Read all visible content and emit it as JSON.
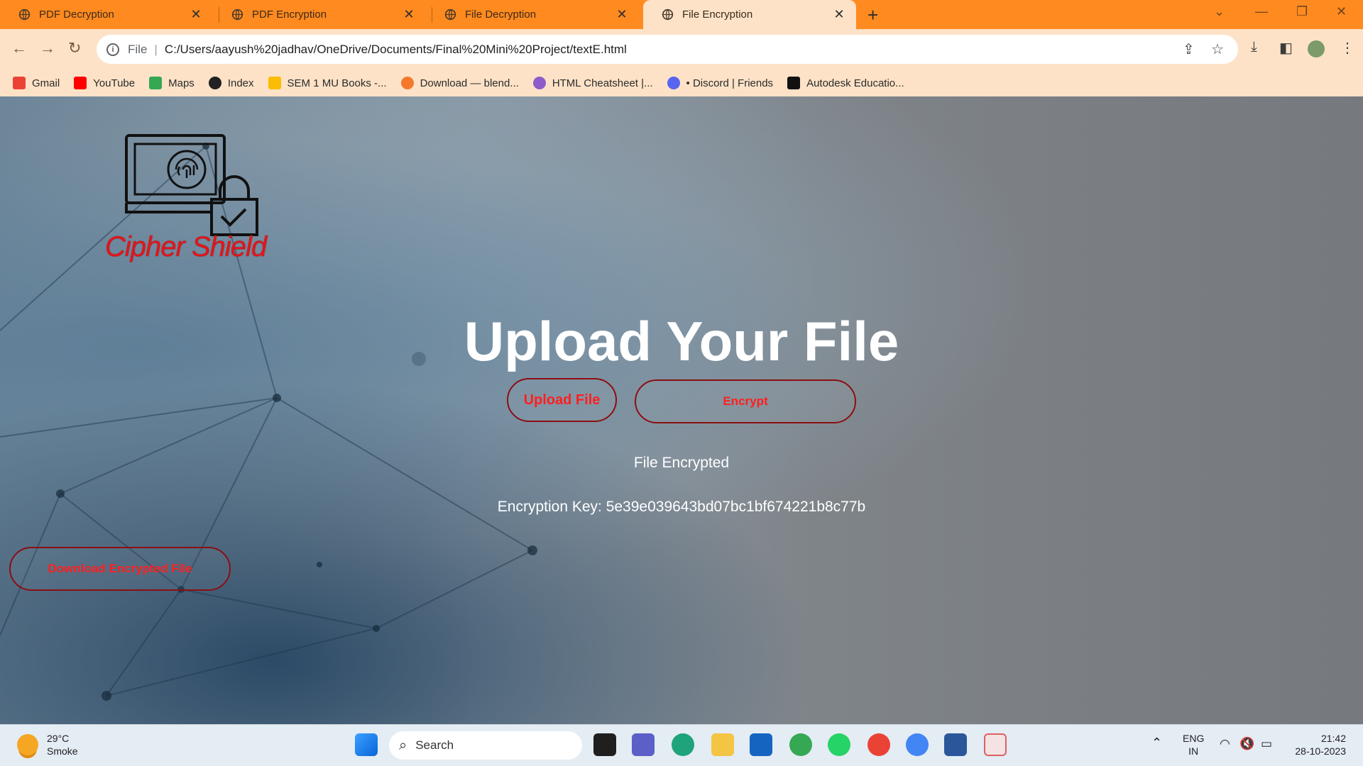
{
  "browser": {
    "tabs": [
      {
        "label": "PDF Decryption",
        "active": false
      },
      {
        "label": "PDF Encryption",
        "active": false
      },
      {
        "label": "File Decryption",
        "active": false
      },
      {
        "label": "File Encryption",
        "active": true
      }
    ],
    "address": {
      "scheme": "File",
      "url": "C:/Users/aayush%20jadhav/OneDrive/Documents/Final%20Mini%20Project/textE.html"
    },
    "bookmarks": [
      {
        "label": "Gmail",
        "color": "#ea4335"
      },
      {
        "label": "YouTube",
        "color": "#ff0000"
      },
      {
        "label": "Maps",
        "color": "#34a853"
      },
      {
        "label": "Index",
        "color": "#222222"
      },
      {
        "label": "SEM 1 MU Books -...",
        "color": "#fbbc04"
      },
      {
        "label": "Download — blend...",
        "color": "#f5792a"
      },
      {
        "label": "HTML Cheatsheet |...",
        "color": "#8e5cc9"
      },
      {
        "label": "• Discord | Friends",
        "color": "#5865f2"
      },
      {
        "label": "Autodesk Educatio...",
        "color": "#111111"
      }
    ]
  },
  "page": {
    "brand": "Cipher Shield",
    "heading": "Upload Your File",
    "upload_button": "Upload File",
    "encrypt_button": "Encrypt",
    "status": "File Encrypted",
    "key_label": "Encryption Key: ",
    "key_value": "5e39e039643bd07bc1bf674221b8c77b",
    "download_button": "Download Encrypted File"
  },
  "taskbar": {
    "weather_temp": "29°C",
    "weather_desc": "Smoke",
    "search_placeholder": "Search",
    "lang_top": "ENG",
    "lang_bottom": "IN",
    "time": "21:42",
    "date": "28-10-2023"
  },
  "colors": {
    "accent_red": "#ff1f1f",
    "tabstrip": "#ff8a1f",
    "toolbar": "#fde2c7"
  }
}
